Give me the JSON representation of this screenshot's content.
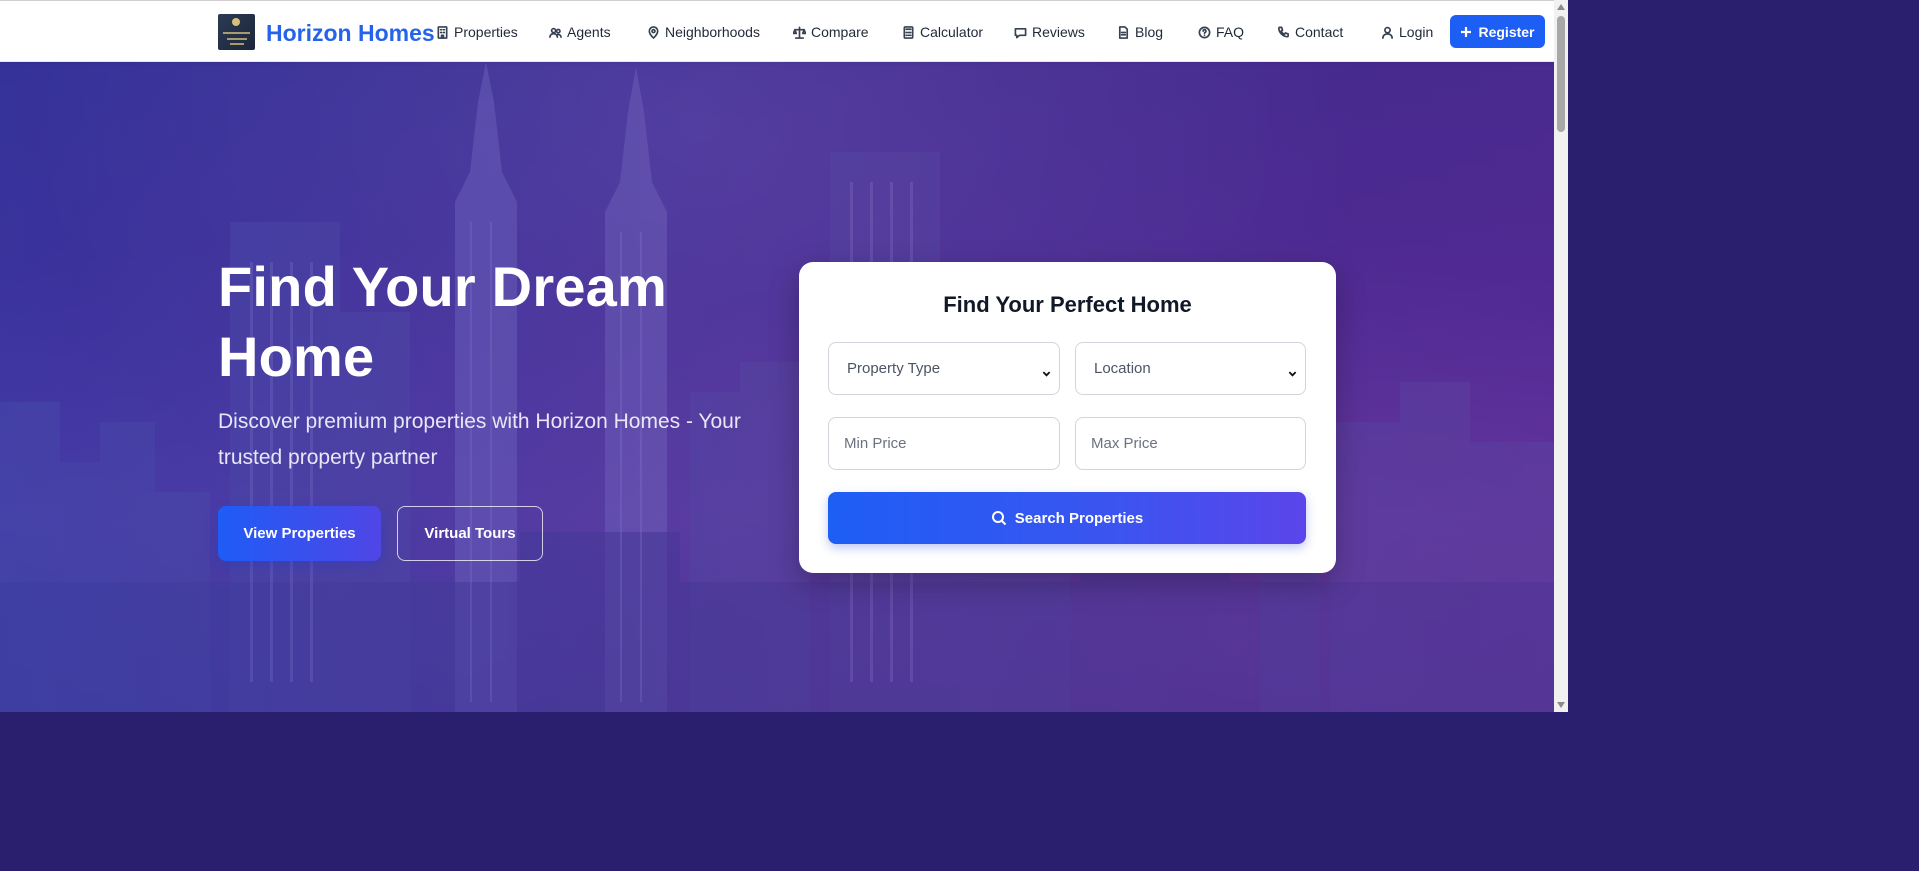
{
  "brand": {
    "name": "Horizon Homes",
    "logo_icon": "horizon-homes-logo"
  },
  "nav": {
    "items": [
      {
        "label": "Properties",
        "icon": "building-icon"
      },
      {
        "label": "Agents",
        "icon": "users-icon"
      },
      {
        "label": "Neighborhoods",
        "icon": "map-pin-icon"
      },
      {
        "label": "Compare",
        "icon": "scale-icon"
      },
      {
        "label": "Calculator",
        "icon": "calculator-icon"
      },
      {
        "label": "Reviews",
        "icon": "message-icon"
      },
      {
        "label": "Blog",
        "icon": "document-icon"
      },
      {
        "label": "FAQ",
        "icon": "help-circle-icon"
      },
      {
        "label": "Contact",
        "icon": "phone-icon"
      },
      {
        "label": "Login",
        "icon": "user-icon"
      }
    ],
    "register_label": "Register"
  },
  "hero": {
    "title": "Find Your Dream Home",
    "subtitle": "Discover premium properties with Horizon Homes - Your trusted property partner",
    "primary_button": "View Properties",
    "secondary_button": "Virtual Tours"
  },
  "search": {
    "title": "Find Your Perfect Home",
    "property_type": "Property Type",
    "location": "Location",
    "min_price_placeholder": "Min Price",
    "max_price_placeholder": "Max Price",
    "button_label": "Search Properties"
  },
  "colors": {
    "brand_blue": "#2563eb",
    "button_blue": "#1d5ef5",
    "gradient_purple": "#5b45ea"
  }
}
